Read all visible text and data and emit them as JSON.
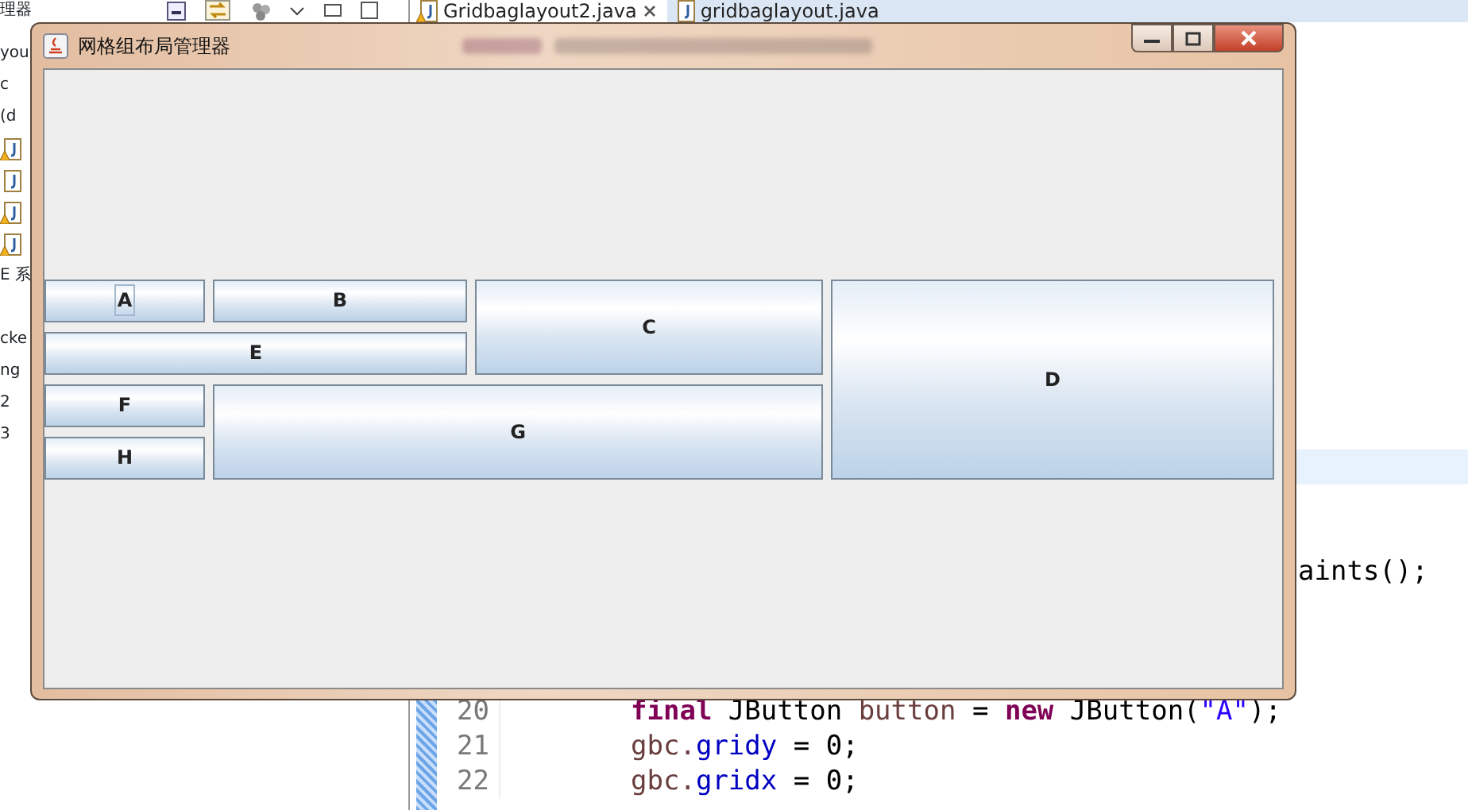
{
  "ide": {
    "left_panel": [
      {
        "kind": "text",
        "text": "you"
      },
      {
        "kind": "text",
        "text": "c"
      },
      {
        "kind": "text",
        "text": "(d"
      },
      {
        "kind": "file",
        "warning": true
      },
      {
        "kind": "file",
        "warning": false
      },
      {
        "kind": "file",
        "warning": true
      },
      {
        "kind": "file",
        "warning": true
      },
      {
        "kind": "text",
        "text": "E 系"
      },
      {
        "kind": "gap"
      },
      {
        "kind": "text",
        "text": "cke"
      },
      {
        "kind": "text",
        "text": "ng"
      },
      {
        "kind": "text",
        "text": "2"
      },
      {
        "kind": "text",
        "text": "3"
      }
    ],
    "panel_title": "理器",
    "tabs": [
      {
        "label": "Gridbaglayout2.java",
        "selected": true,
        "warning": true
      },
      {
        "label": "gridbaglayout.java",
        "selected": false,
        "warning": false
      }
    ],
    "code_lines": [
      {
        "kind": "current"
      },
      {
        "kind": "blank"
      },
      {
        "kind": "blank"
      },
      {
        "kind": "tail",
        "tokens": [
          {
            "text": "aints();",
            "kind": "plain"
          }
        ]
      },
      {
        "kind": "blank"
      },
      {
        "kind": "blank"
      },
      {
        "kind": "blank"
      },
      {
        "kind": "code",
        "number": "20",
        "tokens": [
          {
            "text": "final",
            "kind": "keyword"
          },
          {
            "text": " JButton ",
            "kind": "plain"
          },
          {
            "text": "button",
            "kind": "local"
          },
          {
            "text": " = ",
            "kind": "plain"
          },
          {
            "text": "new",
            "kind": "keyword"
          },
          {
            "text": " JButton(",
            "kind": "plain"
          },
          {
            "text": "\"A\"",
            "kind": "string"
          },
          {
            "text": ");",
            "kind": "plain"
          }
        ]
      },
      {
        "kind": "code",
        "number": "21",
        "tokens": [
          {
            "text": "gbc.",
            "kind": "local"
          },
          {
            "text": "gridy",
            "kind": "field"
          },
          {
            "text": " = 0;",
            "kind": "plain"
          }
        ]
      },
      {
        "kind": "code",
        "number": "22",
        "tokens": [
          {
            "text": "gbc.",
            "kind": "local"
          },
          {
            "text": "gridx",
            "kind": "field"
          },
          {
            "text": " = 0;",
            "kind": "plain"
          }
        ]
      }
    ]
  },
  "window": {
    "title": "网格组布局管理器",
    "buttons": [
      {
        "label": "A",
        "focused": true
      },
      {
        "label": "B",
        "focused": false
      },
      {
        "label": "C",
        "focused": false
      },
      {
        "label": "D",
        "focused": false
      },
      {
        "label": "E",
        "focused": false
      },
      {
        "label": "F",
        "focused": false
      },
      {
        "label": "G",
        "focused": false
      },
      {
        "label": "H",
        "focused": false
      }
    ]
  }
}
